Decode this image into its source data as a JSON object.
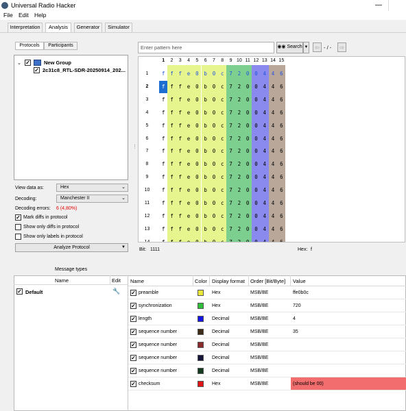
{
  "window": {
    "title": "Universal Radio Hacker",
    "minimize": "—"
  },
  "menu": [
    "File",
    "Edit",
    "Help"
  ],
  "tabs": [
    "Interpretation",
    "Analysis",
    "Generator",
    "Simulator"
  ],
  "subtabs": [
    "Protocols",
    "Participants"
  ],
  "tree": {
    "group": "New Group",
    "item": "2c31c8_RTL-SDR-20250914_202..."
  },
  "options": {
    "view_label": "View data as:",
    "view_value": "Hex",
    "decoding_label": "Decoding:",
    "decoding_value": "Manchester II",
    "errors_label": "Decoding errors:",
    "errors_value": "6 (4,80%)",
    "mark_diffs": "Mark diffs in protocol",
    "show_only_diffs": "Show only diffs in protocol",
    "show_only_labels": "Show only labels in protocol",
    "analyze": "Analyze Protocol"
  },
  "search": {
    "placeholder": "Enter pattern here",
    "button": "Search",
    "counter": "-  /  -"
  },
  "grid": {
    "columns": [
      "1",
      "2",
      "3",
      "4",
      "5",
      "6",
      "7",
      "8",
      "9",
      "10",
      "11",
      "12",
      "13",
      "14",
      "15"
    ],
    "rows": [
      "1",
      "2",
      "3",
      "4",
      "5",
      "6",
      "7",
      "8",
      "9",
      "10",
      "11",
      "12",
      "13",
      "14"
    ],
    "values": [
      "f",
      "f",
      "f",
      "e",
      "0",
      "b",
      "0",
      "c",
      "7",
      "2",
      "0",
      "0",
      "4",
      "4",
      "6"
    ],
    "col_colors": [
      "#ffffff",
      "#e7f58e",
      "#e7f58e",
      "#e7f58e",
      "#e7f58e",
      "#e7f58e",
      "#e7f58e",
      "#e7f58e",
      "#7dcf8f",
      "#7dcf8f",
      "#7dcf8f",
      "#8a8aee",
      "#8a8aee",
      "#b9a89a",
      "#b9a89a"
    ],
    "row1_color": "#2255dd",
    "selected_color": "#1c6fd1"
  },
  "status": {
    "bit_label": "Bit:",
    "bit_value": "1111",
    "hex_label": "Hex:",
    "hex_value": "f"
  },
  "message_types": {
    "title": "Message types",
    "col_name": "Name",
    "col_edit": "Edit",
    "default": "Default"
  },
  "labels_table": {
    "headers": [
      "Name",
      "Color",
      "Display format",
      "Order [Bit/Byte]",
      "Value"
    ],
    "rows": [
      {
        "name": "preamble",
        "color": "#ece73b",
        "format": "Hex",
        "order": "MSB/BE",
        "value": "ffe0b0c"
      },
      {
        "name": "synchronization",
        "color": "#2fbf3a",
        "format": "Hex",
        "order": "MSB/BE",
        "value": "720"
      },
      {
        "name": "length",
        "color": "#1414e6",
        "format": "Decimal",
        "order": "MSB/BE",
        "value": "4"
      },
      {
        "name": "sequence number",
        "color": "#3d2a17",
        "format": "Decimal",
        "order": "MSB/BE",
        "value": "35"
      },
      {
        "name": "sequence number",
        "color": "#8a2a2a",
        "format": "Decimal",
        "order": "MSB/BE",
        "value": ""
      },
      {
        "name": "sequence number",
        "color": "#14143a",
        "format": "Decimal",
        "order": "MSB/BE",
        "value": ""
      },
      {
        "name": "sequence number",
        "color": "#143a20",
        "format": "Decimal",
        "order": "MSB/BE",
        "value": ""
      },
      {
        "name": "checksum",
        "color": "#e01414",
        "format": "Hex",
        "order": "MSB/BE",
        "value": "(should be 00)"
      }
    ]
  },
  "colors": {
    "checksum_bg": "#f26d6d"
  }
}
